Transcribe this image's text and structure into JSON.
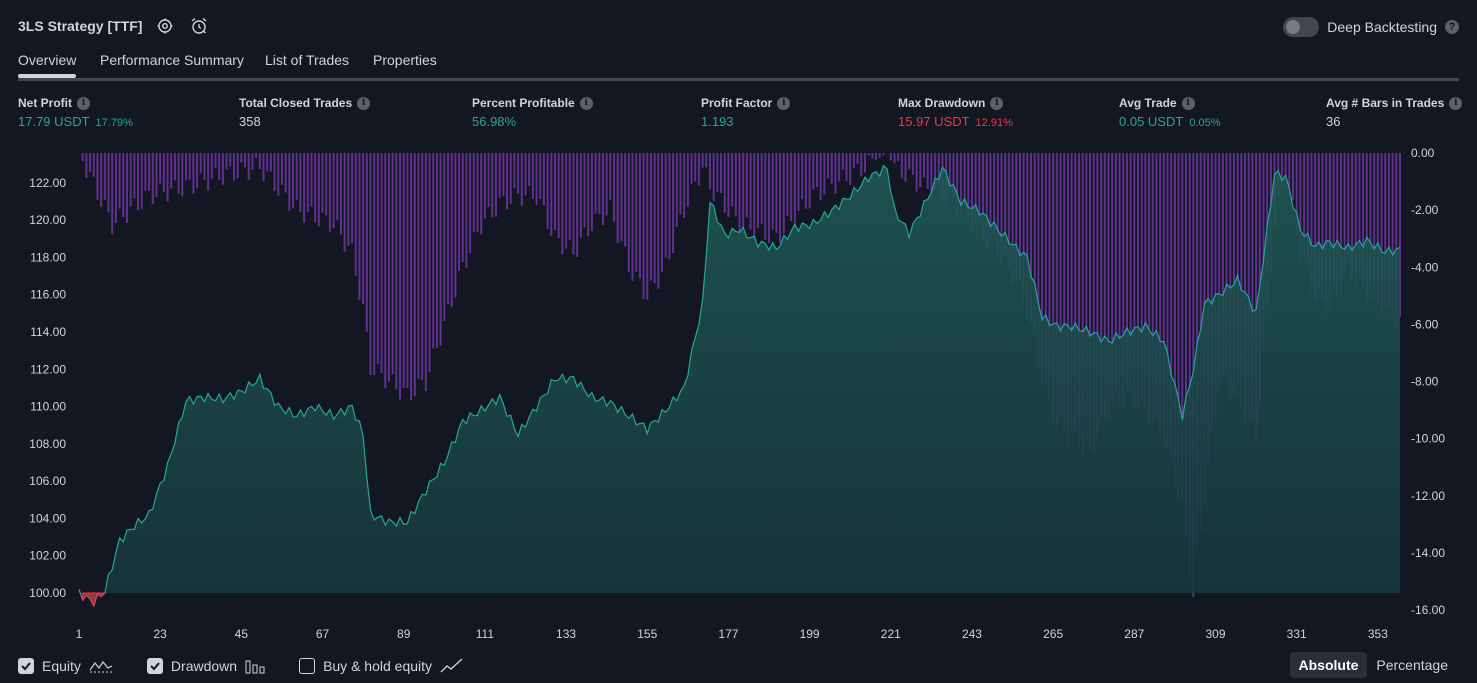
{
  "header": {
    "title": "3LS Strategy [TTF]",
    "deep_backtesting_label": "Deep Backtesting",
    "help_glyph": "?"
  },
  "tabs": [
    "Overview",
    "Performance Summary",
    "List of Trades",
    "Properties"
  ],
  "stats": [
    {
      "label": "Net Profit",
      "value": "17.79 USDT",
      "pct": "17.79%",
      "color": "#26a69a"
    },
    {
      "label": "Total Closed Trades",
      "value": "358",
      "pct": "",
      "color": "#d1d4dc"
    },
    {
      "label": "Percent Profitable",
      "value": "56.98%",
      "pct": "",
      "color": "#26a69a"
    },
    {
      "label": "Profit Factor",
      "value": "1.193",
      "pct": "",
      "color": "#26a69a"
    },
    {
      "label": "Max Drawdown",
      "value": "15.97 USDT",
      "pct": "12.91%",
      "color": "#f23645"
    },
    {
      "label": "Avg Trade",
      "value": "0.05 USDT",
      "pct": "0.05%",
      "color": "#26a69a"
    },
    {
      "label": "Avg # Bars in Trades",
      "value": "36",
      "pct": "",
      "color": "#d1d4dc"
    }
  ],
  "legend": {
    "equity": "Equity",
    "drawdown": "Drawdown",
    "buy_hold": "Buy & hold equity"
  },
  "view_mode": {
    "absolute": "Absolute",
    "percentage": "Percentage"
  },
  "chart_data": {
    "type": "area",
    "x_ticks": [
      1,
      23,
      45,
      67,
      89,
      111,
      133,
      155,
      177,
      199,
      221,
      243,
      265,
      287,
      309,
      331,
      353
    ],
    "y_left_ticks": [
      "100.00",
      "102.00",
      "104.00",
      "106.00",
      "108.00",
      "110.00",
      "112.00",
      "114.00",
      "116.00",
      "118.00",
      "120.00",
      "122.00"
    ],
    "y_right_ticks": [
      "0.00",
      "-2.00",
      "-4.00",
      "-6.00",
      "-8.00",
      "-10.00",
      "-12.00",
      "-14.00",
      "-16.00"
    ],
    "y_left_range": [
      100,
      123.6
    ],
    "y_right_range": [
      -16,
      0
    ],
    "x_range": [
      1,
      359
    ],
    "series": [
      {
        "name": "Equity",
        "color": "#26a69a",
        "x": [
          1,
          5,
          8,
          12,
          16,
          20,
          25,
          30,
          35,
          40,
          45,
          50,
          55,
          60,
          65,
          70,
          75,
          78,
          80,
          85,
          90,
          95,
          100,
          105,
          110,
          115,
          120,
          125,
          130,
          135,
          140,
          145,
          150,
          155,
          160,
          165,
          170,
          172,
          176,
          180,
          185,
          190,
          195,
          200,
          205,
          210,
          215,
          220,
          222,
          226,
          230,
          235,
          240,
          245,
          250,
          255,
          258,
          262,
          266,
          270,
          275,
          280,
          285,
          290,
          295,
          300,
          303,
          306,
          310,
          315,
          320,
          325,
          328,
          332,
          336,
          340,
          345,
          350,
          355,
          359
        ],
        "values": [
          100,
          99.5,
          100.1,
          102.8,
          103.6,
          104.2,
          106.8,
          110.3,
          110.5,
          110.4,
          110.8,
          111.5,
          110.0,
          109.5,
          110.0,
          109.5,
          110.0,
          108.5,
          104.2,
          103.8,
          103.8,
          105.5,
          107.0,
          109.2,
          109.8,
          110.5,
          108.5,
          110.0,
          111.5,
          111.5,
          110.5,
          110.2,
          109.5,
          108.8,
          109.8,
          111.0,
          115.5,
          121.0,
          119.2,
          119.5,
          118.8,
          118.5,
          119.6,
          119.8,
          120.5,
          121.3,
          122.3,
          122.8,
          120.5,
          119.3,
          120.8,
          122.8,
          121.0,
          120.5,
          119.5,
          118.5,
          118.0,
          114.8,
          114.3,
          114.3,
          114.0,
          113.5,
          114.0,
          114.3,
          113.5,
          109.5,
          112.0,
          115.5,
          116.0,
          116.8,
          115.0,
          122.5,
          122.3,
          119.5,
          118.6,
          118.8,
          118.5,
          118.9,
          118.3,
          118.4
        ]
      },
      {
        "name": "Drawdown",
        "color": "#7b3bb5",
        "x": [
          1,
          10,
          20,
          30,
          40,
          50,
          60,
          70,
          75,
          78,
          80,
          85,
          90,
          95,
          100,
          105,
          110,
          115,
          120,
          125,
          130,
          135,
          140,
          145,
          150,
          155,
          160,
          165,
          170,
          172,
          180,
          190,
          200,
          210,
          220,
          222,
          230,
          235,
          240,
          245,
          250,
          255,
          258,
          262,
          266,
          270,
          275,
          280,
          285,
          290,
          295,
          300,
          303,
          306,
          310,
          315,
          320,
          325,
          328,
          332,
          336,
          340,
          345,
          350,
          355,
          359
        ],
        "values": [
          0,
          -2.5,
          -1.5,
          -1.2,
          -0.8,
          -0.5,
          -2.0,
          -2.5,
          -3.5,
          -5.5,
          -7.5,
          -8.0,
          -8.5,
          -8.0,
          -6.0,
          -4.0,
          -2.5,
          -1.8,
          -1.5,
          -1.5,
          -3.0,
          -3.5,
          -2.5,
          -2.0,
          -4.0,
          -5.0,
          -4.0,
          -2.0,
          -0.5,
          -1.2,
          -2.5,
          -3.0,
          -1.5,
          -0.8,
          0,
          -0.5,
          -1.2,
          -1.5,
          -2.0,
          -2.8,
          -3.5,
          -4.5,
          -5.5,
          -8.0,
          -9.5,
          -10.0,
          -10.5,
          -9.0,
          -8.5,
          -9.0,
          -10.0,
          -12.5,
          -15.5,
          -12.0,
          -8.0,
          -8.5,
          -10.0,
          -2.5,
          -0.5,
          -3.5,
          -5.0,
          -5.5,
          -4.0,
          -5.0,
          -5.5,
          -6.0
        ]
      }
    ]
  }
}
